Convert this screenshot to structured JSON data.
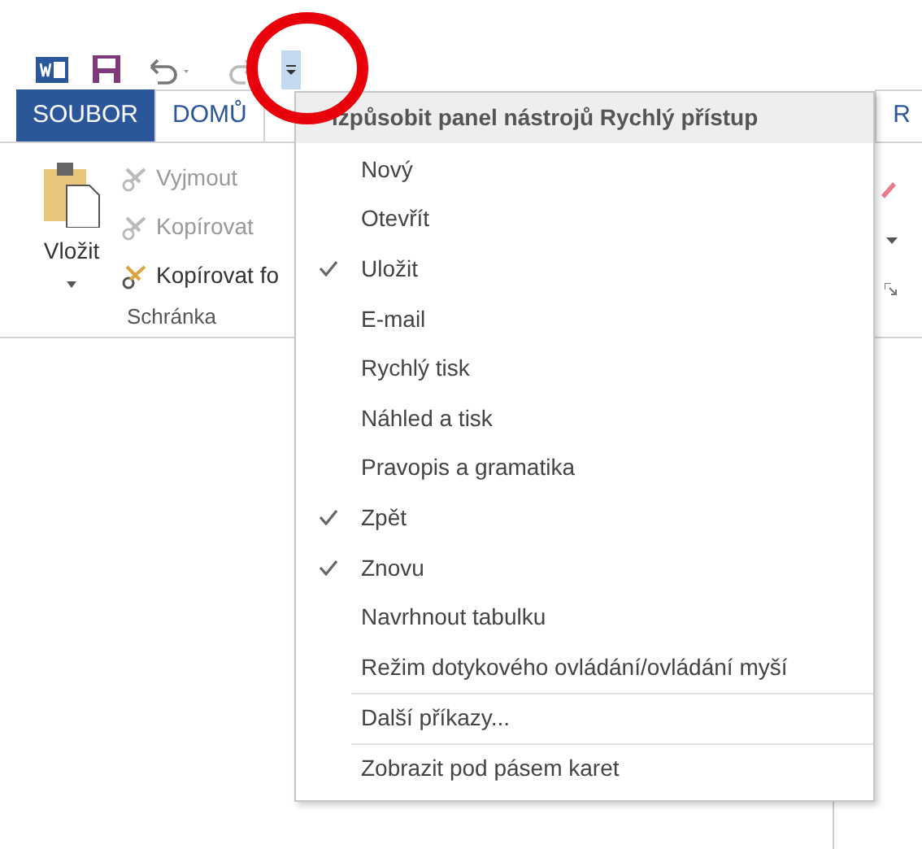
{
  "ribbon_tabs": [
    {
      "label": "SOUBOR",
      "kind": "file"
    },
    {
      "label": "DOMŮ",
      "kind": "tab"
    },
    {
      "label": "R",
      "kind": "tab"
    }
  ],
  "clipboard": {
    "paste": "Vložit",
    "actions": [
      {
        "label": "Vyjmout",
        "disabled": true
      },
      {
        "label": "Kopírovat",
        "disabled": true
      },
      {
        "label": "Kopírovat fo",
        "disabled": false
      }
    ],
    "group": "Schránka"
  },
  "menu": {
    "title": "izpůsobit panel nástrojů Rychlý přístup",
    "items": [
      {
        "label": "Nový",
        "checked": false
      },
      {
        "label": "Otevřít",
        "checked": false
      },
      {
        "label": "Uložit",
        "checked": true
      },
      {
        "label": "E-mail",
        "checked": false
      },
      {
        "label": "Rychlý tisk",
        "checked": false
      },
      {
        "label": "Náhled a tisk",
        "checked": false
      },
      {
        "label": "Pravopis a gramatika",
        "checked": false
      },
      {
        "label": "Zpět",
        "checked": true
      },
      {
        "label": "Znovu",
        "checked": true
      },
      {
        "label": "Navrhnout tabulku",
        "checked": false
      },
      {
        "label": "Režim dotykového ovládání/ovládání myší",
        "checked": false
      }
    ],
    "more": [
      {
        "label": "Další příkazy..."
      },
      {
        "label": "Zobrazit pod pásem karet"
      }
    ]
  }
}
